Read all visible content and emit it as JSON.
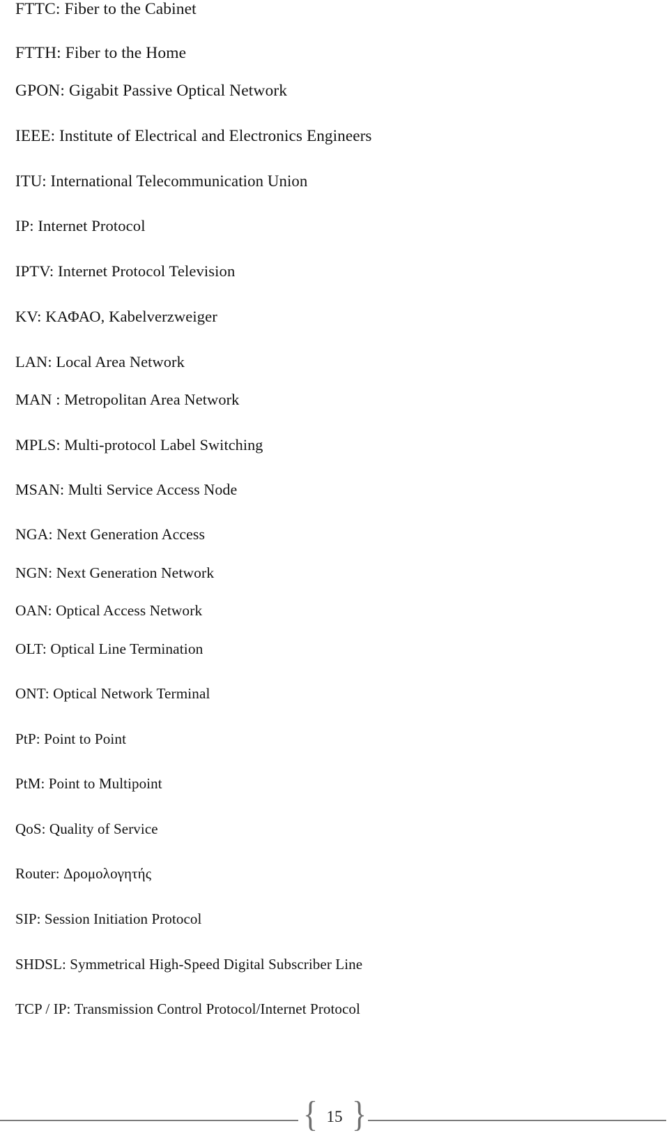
{
  "document": {
    "type": "glossary-abbreviations-list",
    "entries": [
      "FTTC: Fiber to the Cabinet",
      "FTTH: Fiber to the Home",
      "GPON: Gigabit Passive Optical Network",
      "IEEE: Institute of Electrical and Electronics Engineers",
      "ITU: International Telecommunication Union",
      "IP: Internet Protocol",
      "IPTV: Internet Protocol Television",
      "KV: ΚΑΦΑΟ, Kabelverzweiger",
      "LAN: Local Area Network",
      "MAN : Metropolitan Area Network",
      "MPLS: Multi-protocol Label Switching",
      "MSAN: Multi Service Access Node",
      "NGA: Next Generation Access",
      "NGN: Next Generation Network",
      "OAN: Optical Access Network",
      "OLT: Optical Line Termination",
      "ONT: Optical Network Terminal",
      "PtP: Point to Point",
      "PtM: Point to Multipoint",
      "QoS: Quality of Service",
      "Router: Δρομολογητής",
      "SIP: Session Initiation Protocol",
      "SHDSL: Symmetrical High-Speed Digital Subscriber Line",
      "TCP / IP: Transmission Control Protocol/Internet Protocol"
    ]
  },
  "footer": {
    "page_number": "15",
    "left_brace": "{",
    "right_brace": "}",
    "rule_color": "#7b7b7b"
  }
}
